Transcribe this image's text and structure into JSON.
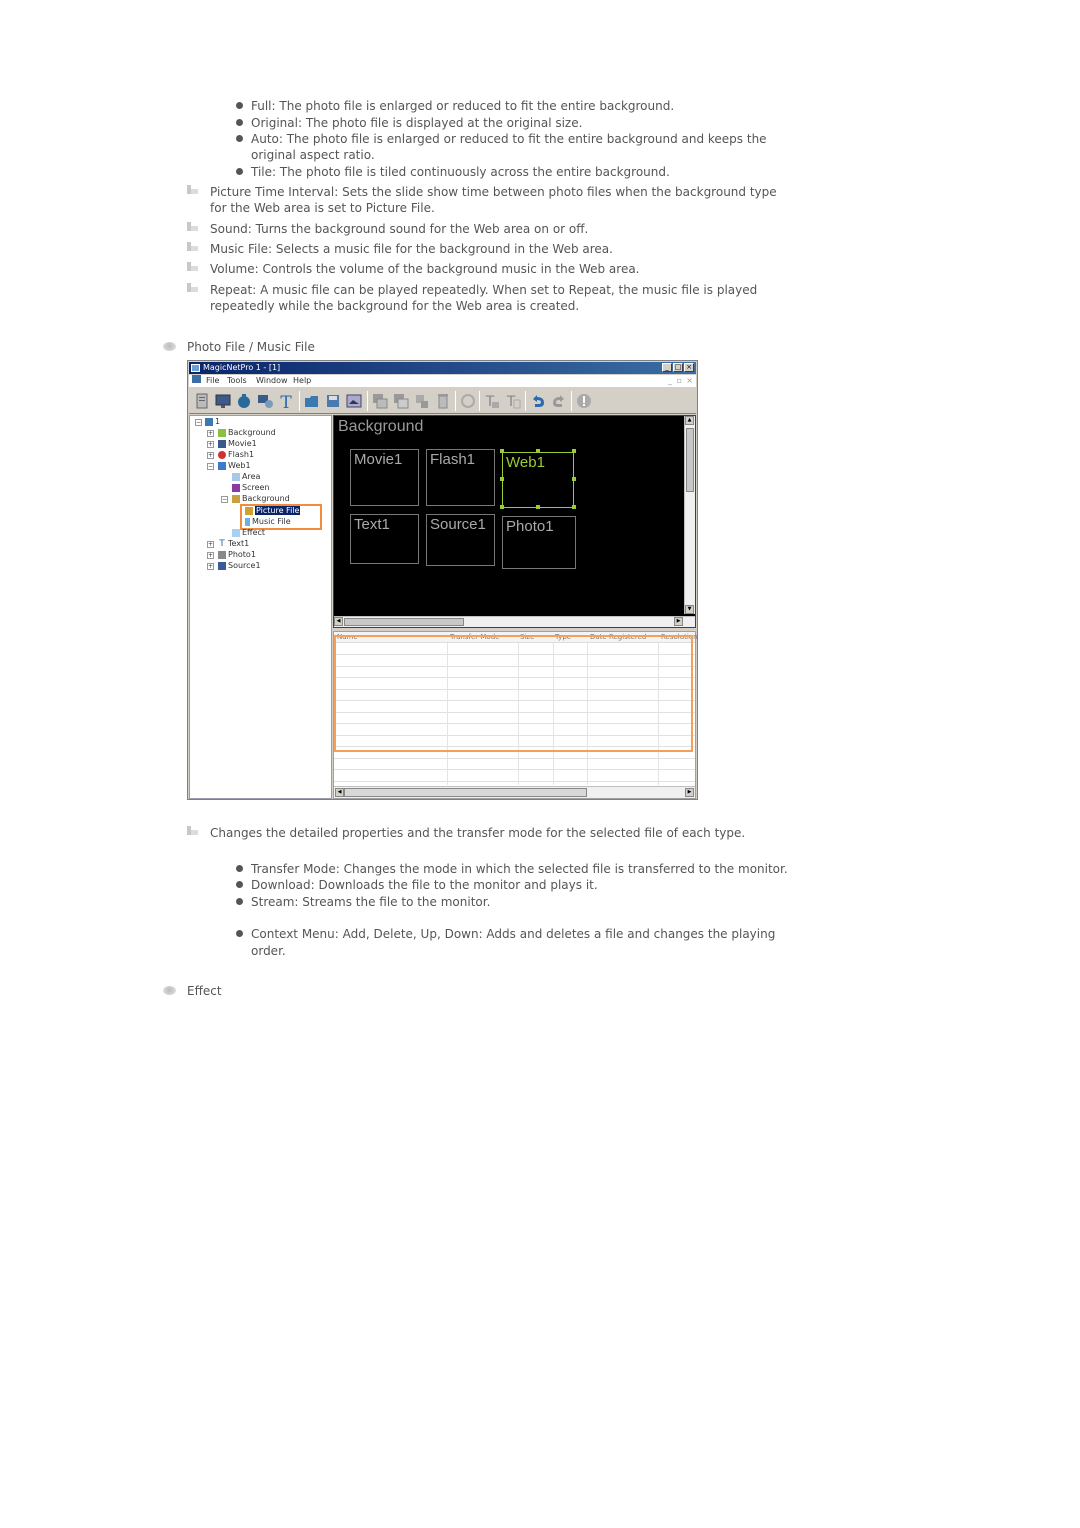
{
  "background_modes": [
    "Full: The photo file is enlarged or reduced to fit the entire background.",
    "Original: The photo file is displayed at the original size.",
    [
      "Auto: The photo file is enlarged or reduced to fit the entire background and keeps the",
      "original aspect ratio."
    ],
    "Tile: The photo file is tiled continuously across the entire background."
  ],
  "settings": [
    [
      "Picture Time Interval: Sets the slide show time between photo files when the background type",
      "for the Web area is set to Picture File."
    ],
    [
      "Sound: Turns the background sound for the Web area on or off."
    ],
    [
      "Music File: Selects a music file for the background in the Web area."
    ],
    [
      "Volume: Controls the volume of the background music in the Web area."
    ],
    [
      "Repeat: A music file can be played repeatedly. When set to Repeat, the music file is played",
      "repeatedly while the background for the Web area is created."
    ]
  ],
  "section_photo_music": "Photo File / Music File",
  "screenshot": {
    "title": "MagicNetPro 1 - [1]",
    "menu": [
      "File",
      "Tools",
      "Window",
      "Help"
    ],
    "toolbar_icons": [
      "new-icon",
      "monitor-icon",
      "camera-icon",
      "network-icon",
      "text-icon",
      "open-folder-icon",
      "save-icon",
      "image-icon",
      "copy-area-icon",
      "paste-area-icon",
      "move-icon",
      "delete-icon",
      "refresh-icon",
      "align-text-left-icon",
      "align-text-right-icon",
      "undo-icon",
      "redo-icon",
      "info-icon"
    ],
    "tree": {
      "root": "1",
      "items": [
        "Background",
        "Movie1",
        "Flash1",
        "Web1",
        "Area",
        "Screen",
        "Background",
        "Picture File",
        "Music File",
        "Effect",
        "Text1",
        "Photo1",
        "Source1"
      ],
      "selected": "Picture File"
    },
    "canvas": {
      "label": "Background",
      "areas": [
        "Movie1",
        "Flash1",
        "Web1",
        "Text1",
        "Source1",
        "Photo1"
      ],
      "selected_area": "Web1"
    },
    "file_list": {
      "columns": [
        "Name",
        "Transfer Mode",
        "Size",
        "Type",
        "Date Registered",
        "Resolution"
      ]
    }
  },
  "description": "Changes the detailed properties and the transfer mode for the selected file of each type.",
  "transfer_modes": [
    "Transfer Mode: Changes the mode in which the selected file is transferred to the monitor.",
    "Download: Downloads the file to the monitor and plays it.",
    "Stream: Streams the file to the monitor."
  ],
  "context_menu": [
    "Context Menu: Add, Delete, Up, Down: Adds and deletes a file and changes the playing",
    "order."
  ],
  "section_effect": "Effect"
}
